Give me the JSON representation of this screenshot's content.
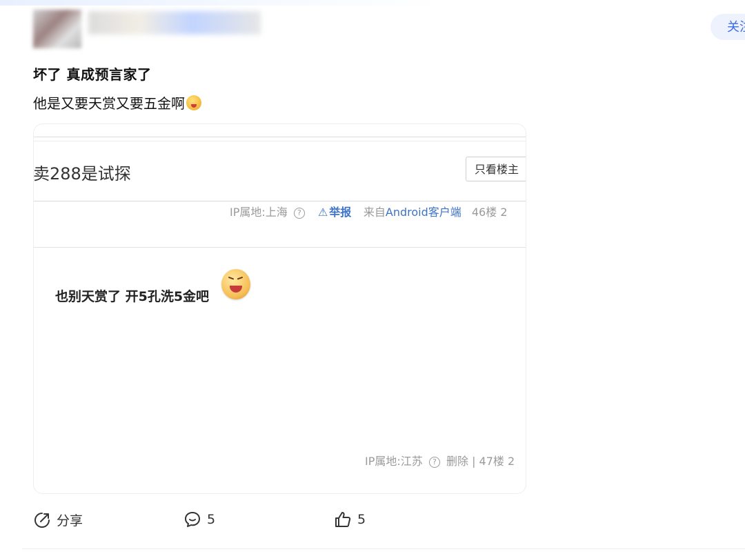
{
  "post": {
    "follow_label": "关注",
    "title": "坏了 真成预言家了",
    "body": "他是又要天赏又要五金啊"
  },
  "embedded_screenshot": {
    "thread_title": "卖288是试探",
    "only_op_label": "只看楼主",
    "floor46": {
      "ip": "IP属地:上海",
      "report": "举报",
      "from_prefix": "来自",
      "from_client": "Android客户端",
      "floor": "46楼",
      "trailing": "2"
    },
    "reply_text": "也别天赏了 开5孔洗5金吧",
    "floor47": {
      "ip": "IP属地:江苏",
      "delete": "删除",
      "separator": "|",
      "floor": "47楼",
      "trailing": "2"
    }
  },
  "actions": {
    "share_label": "分享",
    "comment_count": "5",
    "like_count": "5"
  },
  "colors": {
    "accent": "#3b6ae8",
    "link": "#3e73c7",
    "meta": "#9a9a9a"
  },
  "icons": [
    "share-icon",
    "comment-icon",
    "thumbs-up-icon",
    "help-circle-icon",
    "warning-icon",
    "emoji-icon"
  ]
}
